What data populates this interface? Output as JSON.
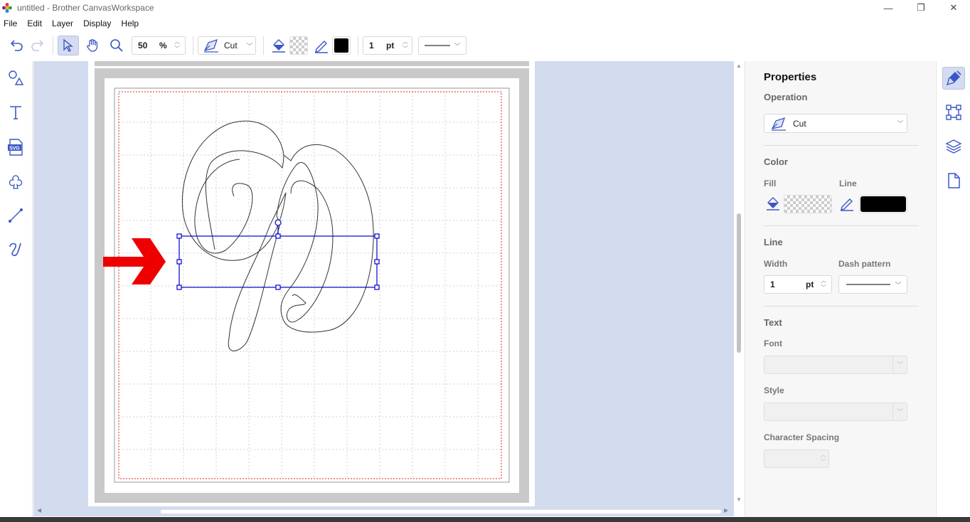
{
  "window": {
    "title": "untitled - Brother CanvasWorkspace",
    "minimize": "—",
    "maximize": "❐",
    "close": "✕"
  },
  "menu": [
    "File",
    "Edit",
    "Layer",
    "Display",
    "Help"
  ],
  "toolbar": {
    "zoom_value": "50",
    "zoom_unit": "%",
    "operation": "Cut",
    "line_width": "1",
    "line_width_unit": "pt",
    "line_color": "#000000"
  },
  "properties": {
    "title": "Properties",
    "operation_label": "Operation",
    "operation_value": "Cut",
    "color_label": "Color",
    "fill_label": "Fill",
    "line_label": "Line",
    "line_color": "#000000",
    "line_section_label": "Line",
    "width_label": "Width",
    "width_value": "1",
    "width_unit": "pt",
    "dash_label": "Dash pattern",
    "text_label": "Text",
    "font_label": "Font",
    "style_label": "Style",
    "spacing_label": "Character Spacing"
  },
  "colors": {
    "accent": "#3a56c8",
    "canvas_bg": "#d3dbef",
    "selection": "#0000cc",
    "arrow": "#ee0000"
  }
}
